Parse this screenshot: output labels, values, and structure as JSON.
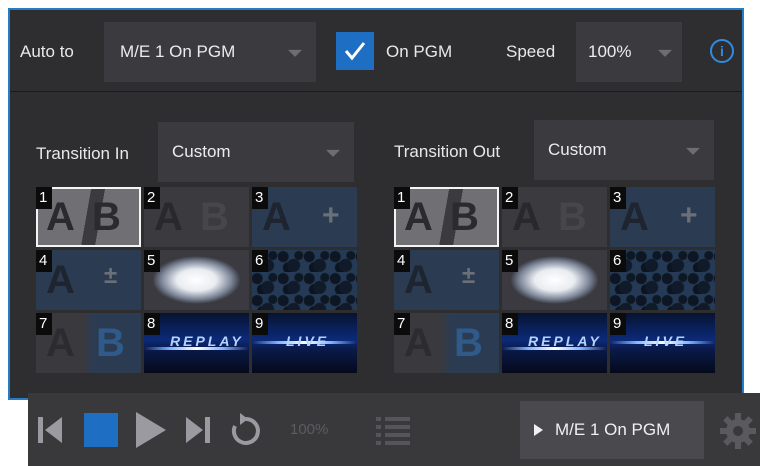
{
  "header": {
    "auto_to_label": "Auto to",
    "auto_to_value": "M/E 1 On PGM",
    "on_pgm_label": "On PGM",
    "on_pgm_checked": true,
    "speed_label": "Speed",
    "speed_value": "100%",
    "info_glyph": "i"
  },
  "transition_in": {
    "label": "Transition In",
    "value": "Custom",
    "tiles": [
      {
        "num": "1",
        "kind": "ab-wipe",
        "selected": true
      },
      {
        "num": "2",
        "kind": "ab-dissolve",
        "selected": false
      },
      {
        "num": "3",
        "kind": "a-plus",
        "selected": false
      },
      {
        "num": "4",
        "kind": "a-plusminus",
        "selected": false
      },
      {
        "num": "5",
        "kind": "soft-blur",
        "selected": false
      },
      {
        "num": "6",
        "kind": "texture",
        "selected": false
      },
      {
        "num": "7",
        "kind": "ab-blue",
        "selected": false
      },
      {
        "num": "8",
        "kind": "replay",
        "selected": false
      },
      {
        "num": "9",
        "kind": "live",
        "selected": false
      }
    ]
  },
  "transition_out": {
    "label": "Transition Out",
    "value": "Custom",
    "tiles": [
      {
        "num": "1",
        "kind": "ab-wipe",
        "selected": true
      },
      {
        "num": "2",
        "kind": "ab-dissolve",
        "selected": false
      },
      {
        "num": "3",
        "kind": "a-plus",
        "selected": false
      },
      {
        "num": "4",
        "kind": "a-plusminus",
        "selected": false
      },
      {
        "num": "5",
        "kind": "soft-blur",
        "selected": false
      },
      {
        "num": "6",
        "kind": "texture",
        "selected": false
      },
      {
        "num": "7",
        "kind": "ab-blue",
        "selected": false
      },
      {
        "num": "8",
        "kind": "replay",
        "selected": false
      },
      {
        "num": "9",
        "kind": "live",
        "selected": false
      }
    ]
  },
  "transport": {
    "speed_value": "100%",
    "me_button_label": "M/E 1 On PGM",
    "icons": [
      "skip-back-icon",
      "stop-icon",
      "play-icon",
      "skip-forward-icon",
      "loop-icon",
      "playlist-icon",
      "gear-icon"
    ]
  },
  "colors": {
    "accent": "#1e6fc4",
    "border": "#2b7bc4",
    "panel": "#2e2e31"
  }
}
